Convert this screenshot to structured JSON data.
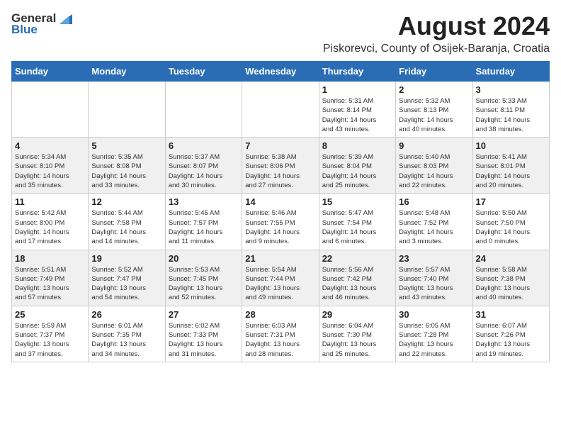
{
  "header": {
    "logo_general": "General",
    "logo_blue": "Blue",
    "month_year": "August 2024",
    "location": "Piskorevci, County of Osijek-Baranja, Croatia"
  },
  "weekdays": [
    "Sunday",
    "Monday",
    "Tuesday",
    "Wednesday",
    "Thursday",
    "Friday",
    "Saturday"
  ],
  "weeks": [
    [
      {
        "day": "",
        "info": ""
      },
      {
        "day": "",
        "info": ""
      },
      {
        "day": "",
        "info": ""
      },
      {
        "day": "",
        "info": ""
      },
      {
        "day": "1",
        "info": "Sunrise: 5:31 AM\nSunset: 8:14 PM\nDaylight: 14 hours\nand 43 minutes."
      },
      {
        "day": "2",
        "info": "Sunrise: 5:32 AM\nSunset: 8:13 PM\nDaylight: 14 hours\nand 40 minutes."
      },
      {
        "day": "3",
        "info": "Sunrise: 5:33 AM\nSunset: 8:11 PM\nDaylight: 14 hours\nand 38 minutes."
      }
    ],
    [
      {
        "day": "4",
        "info": "Sunrise: 5:34 AM\nSunset: 8:10 PM\nDaylight: 14 hours\nand 35 minutes."
      },
      {
        "day": "5",
        "info": "Sunrise: 5:35 AM\nSunset: 8:08 PM\nDaylight: 14 hours\nand 33 minutes."
      },
      {
        "day": "6",
        "info": "Sunrise: 5:37 AM\nSunset: 8:07 PM\nDaylight: 14 hours\nand 30 minutes."
      },
      {
        "day": "7",
        "info": "Sunrise: 5:38 AM\nSunset: 8:06 PM\nDaylight: 14 hours\nand 27 minutes."
      },
      {
        "day": "8",
        "info": "Sunrise: 5:39 AM\nSunset: 8:04 PM\nDaylight: 14 hours\nand 25 minutes."
      },
      {
        "day": "9",
        "info": "Sunrise: 5:40 AM\nSunset: 8:03 PM\nDaylight: 14 hours\nand 22 minutes."
      },
      {
        "day": "10",
        "info": "Sunrise: 5:41 AM\nSunset: 8:01 PM\nDaylight: 14 hours\nand 20 minutes."
      }
    ],
    [
      {
        "day": "11",
        "info": "Sunrise: 5:42 AM\nSunset: 8:00 PM\nDaylight: 14 hours\nand 17 minutes."
      },
      {
        "day": "12",
        "info": "Sunrise: 5:44 AM\nSunset: 7:58 PM\nDaylight: 14 hours\nand 14 minutes."
      },
      {
        "day": "13",
        "info": "Sunrise: 5:45 AM\nSunset: 7:57 PM\nDaylight: 14 hours\nand 11 minutes."
      },
      {
        "day": "14",
        "info": "Sunrise: 5:46 AM\nSunset: 7:55 PM\nDaylight: 14 hours\nand 9 minutes."
      },
      {
        "day": "15",
        "info": "Sunrise: 5:47 AM\nSunset: 7:54 PM\nDaylight: 14 hours\nand 6 minutes."
      },
      {
        "day": "16",
        "info": "Sunrise: 5:48 AM\nSunset: 7:52 PM\nDaylight: 14 hours\nand 3 minutes."
      },
      {
        "day": "17",
        "info": "Sunrise: 5:50 AM\nSunset: 7:50 PM\nDaylight: 14 hours\nand 0 minutes."
      }
    ],
    [
      {
        "day": "18",
        "info": "Sunrise: 5:51 AM\nSunset: 7:49 PM\nDaylight: 13 hours\nand 57 minutes."
      },
      {
        "day": "19",
        "info": "Sunrise: 5:52 AM\nSunset: 7:47 PM\nDaylight: 13 hours\nand 54 minutes."
      },
      {
        "day": "20",
        "info": "Sunrise: 5:53 AM\nSunset: 7:45 PM\nDaylight: 13 hours\nand 52 minutes."
      },
      {
        "day": "21",
        "info": "Sunrise: 5:54 AM\nSunset: 7:44 PM\nDaylight: 13 hours\nand 49 minutes."
      },
      {
        "day": "22",
        "info": "Sunrise: 5:56 AM\nSunset: 7:42 PM\nDaylight: 13 hours\nand 46 minutes."
      },
      {
        "day": "23",
        "info": "Sunrise: 5:57 AM\nSunset: 7:40 PM\nDaylight: 13 hours\nand 43 minutes."
      },
      {
        "day": "24",
        "info": "Sunrise: 5:58 AM\nSunset: 7:38 PM\nDaylight: 13 hours\nand 40 minutes."
      }
    ],
    [
      {
        "day": "25",
        "info": "Sunrise: 5:59 AM\nSunset: 7:37 PM\nDaylight: 13 hours\nand 37 minutes."
      },
      {
        "day": "26",
        "info": "Sunrise: 6:01 AM\nSunset: 7:35 PM\nDaylight: 13 hours\nand 34 minutes."
      },
      {
        "day": "27",
        "info": "Sunrise: 6:02 AM\nSunset: 7:33 PM\nDaylight: 13 hours\nand 31 minutes."
      },
      {
        "day": "28",
        "info": "Sunrise: 6:03 AM\nSunset: 7:31 PM\nDaylight: 13 hours\nand 28 minutes."
      },
      {
        "day": "29",
        "info": "Sunrise: 6:04 AM\nSunset: 7:30 PM\nDaylight: 13 hours\nand 25 minutes."
      },
      {
        "day": "30",
        "info": "Sunrise: 6:05 AM\nSunset: 7:28 PM\nDaylight: 13 hours\nand 22 minutes."
      },
      {
        "day": "31",
        "info": "Sunrise: 6:07 AM\nSunset: 7:26 PM\nDaylight: 13 hours\nand 19 minutes."
      }
    ]
  ]
}
